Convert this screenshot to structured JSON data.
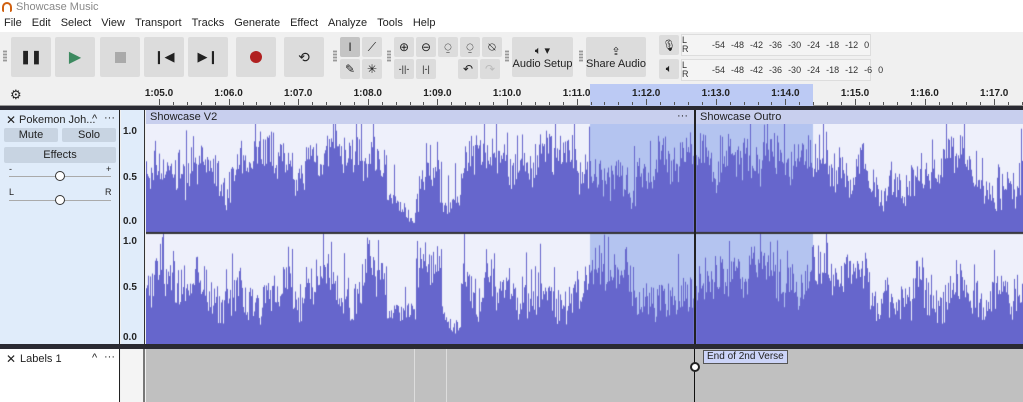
{
  "window": {
    "title": "Showcase Music"
  },
  "menu": [
    "File",
    "Edit",
    "Select",
    "View",
    "Transport",
    "Tracks",
    "Generate",
    "Effect",
    "Analyze",
    "Tools",
    "Help"
  ],
  "toolbar": {
    "audio_setup": "Audio Setup",
    "share_audio": "Share Audio"
  },
  "meters": {
    "record_scale": [
      "-54",
      "-48",
      "-42",
      "-36",
      "-30",
      "-24",
      "-18",
      "-12",
      "0"
    ],
    "play_scale": [
      "-54",
      "-48",
      "-42",
      "-36",
      "-30",
      "-24",
      "-18",
      "-12",
      "-6",
      "0"
    ],
    "channel_l": "L",
    "channel_r": "R"
  },
  "ruler": {
    "labels": [
      "1:05.0",
      "1:06.0",
      "1:07.0",
      "1:08.0",
      "1:09.0",
      "1:10.0",
      "1:11.0",
      "1:12.0",
      "1:13.0",
      "1:14.0",
      "1:15.0",
      "1:16.0",
      "1:17.0"
    ],
    "selection_start": "1:11.25",
    "selection_end": "1:14.4"
  },
  "track": {
    "name": "Pokemon Joh...",
    "mute": "Mute",
    "solo": "Solo",
    "effects": "Effects",
    "gain_minus": "-",
    "gain_plus": "+",
    "pan_l": "L",
    "pan_r": "R",
    "scale": [
      "1.0",
      "0.5",
      "0.0"
    ],
    "clips": [
      {
        "name": "Showcase V2"
      },
      {
        "name": "Showcase Outro"
      }
    ],
    "waveform_color": "#6666cc"
  },
  "label_track": {
    "name": "Labels 1",
    "labels": [
      {
        "text": "End of 2nd Verse"
      }
    ]
  }
}
